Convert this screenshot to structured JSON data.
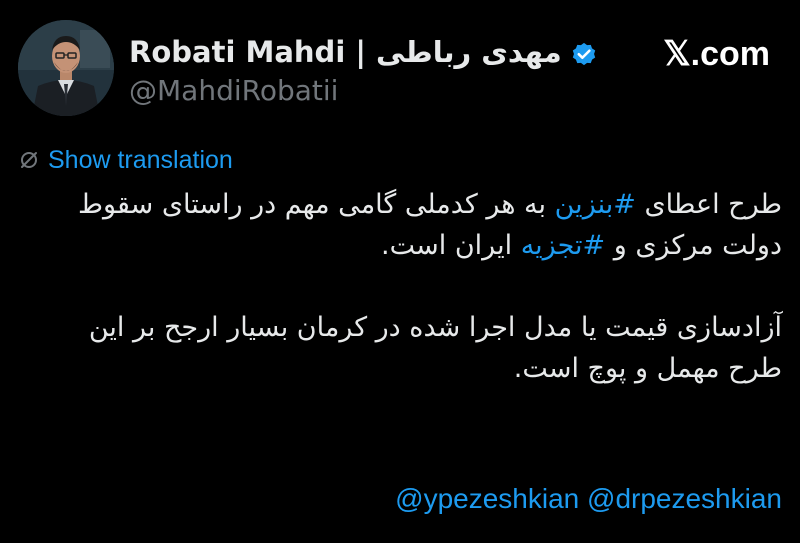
{
  "author": {
    "display_name": "Robati Mahdi | مهدی رباطی",
    "handle": "@MahdiRobatii",
    "verified": true
  },
  "site": {
    "brand": "𝕏.com"
  },
  "translation": {
    "label": "Show translation",
    "icon": "translate-icon"
  },
  "tweet": {
    "line1_prefix": "طرح اعطای ",
    "hashtag1": "#بنزین",
    "line1_suffix": " به هر کدملی گامی مهم در راستای سقوط دولت مرکزی و ",
    "hashtag2": "#تجزیه",
    "line1_end": " ایران است.",
    "paragraph2": "آزادسازی قیمت یا مدل اجرا شده در کرمان بسیار ارجح بر این طرح مهمل و پوچ است.",
    "mention1": "@ypezeshkian",
    "mention2": "@drpezeshkian"
  },
  "colors": {
    "background": "#000000",
    "text": "#e7e9ea",
    "muted": "#71767b",
    "accent": "#1d9bf0"
  }
}
